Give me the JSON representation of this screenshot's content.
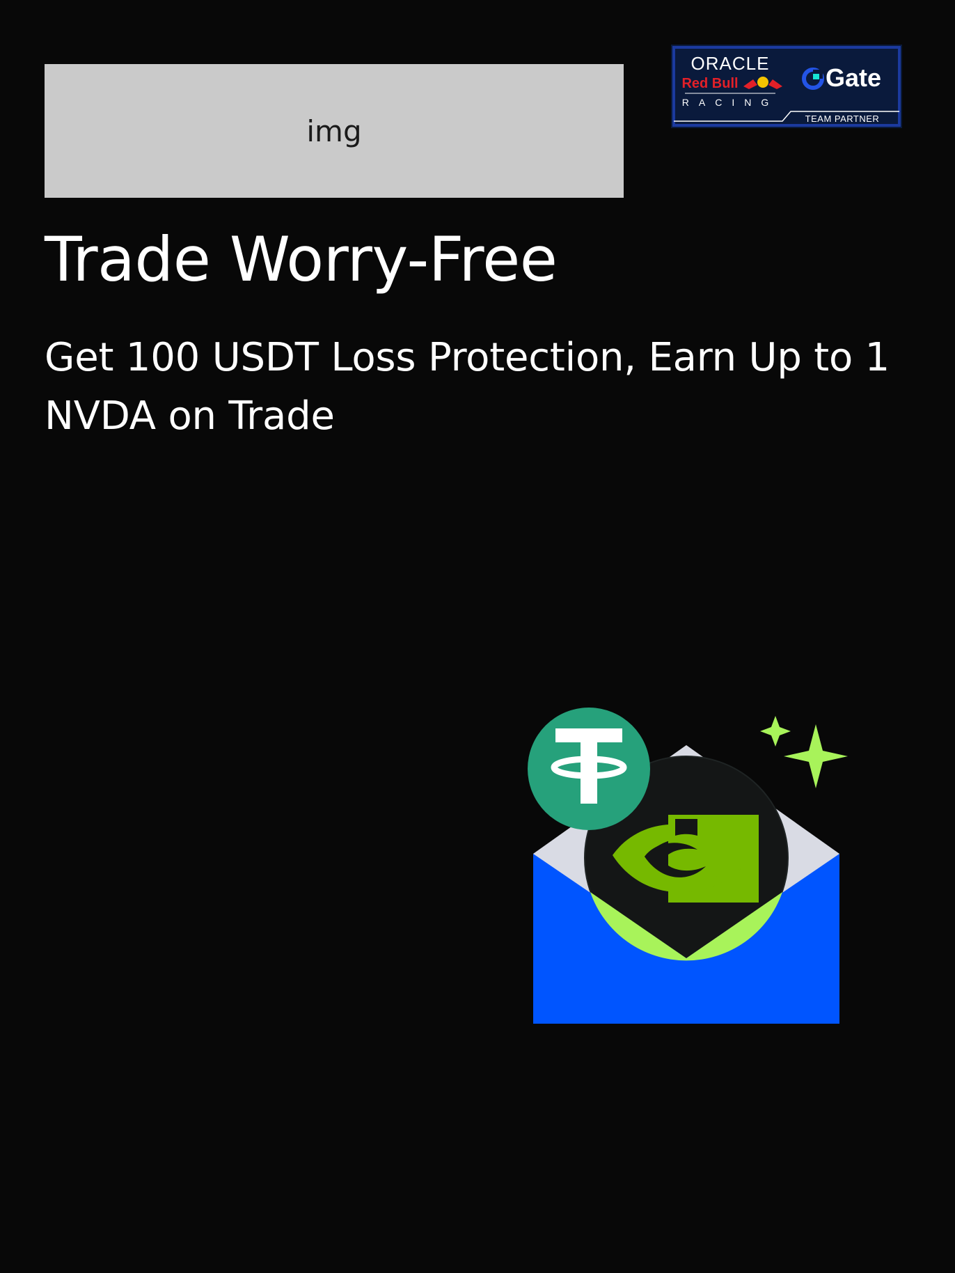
{
  "banner": {
    "image_placeholder_label": "img",
    "partner_logo": {
      "brand_top": "ORACLE",
      "brand_middle": "Red Bull",
      "brand_bottom": "RACING",
      "partner_name": "Gate",
      "partner_tag": "TEAM PARTNER"
    }
  },
  "promo": {
    "headline": "Trade Worry-Free",
    "subheadline": "Get 100 USDT Loss Protection, Earn Up to 1 NVDA on Trade"
  },
  "hero_illustration": {
    "icons": [
      "envelope-icon",
      "tether-usdt-icon",
      "nvidia-icon",
      "sparkle-icon"
    ]
  },
  "colors": {
    "background": "#080808",
    "placeholder_bg": "#cacaca",
    "envelope_blue": "#0055ff",
    "tether_green": "#26a17b",
    "nvidia_green": "#76b900",
    "accent_lime": "#a8f35a"
  }
}
